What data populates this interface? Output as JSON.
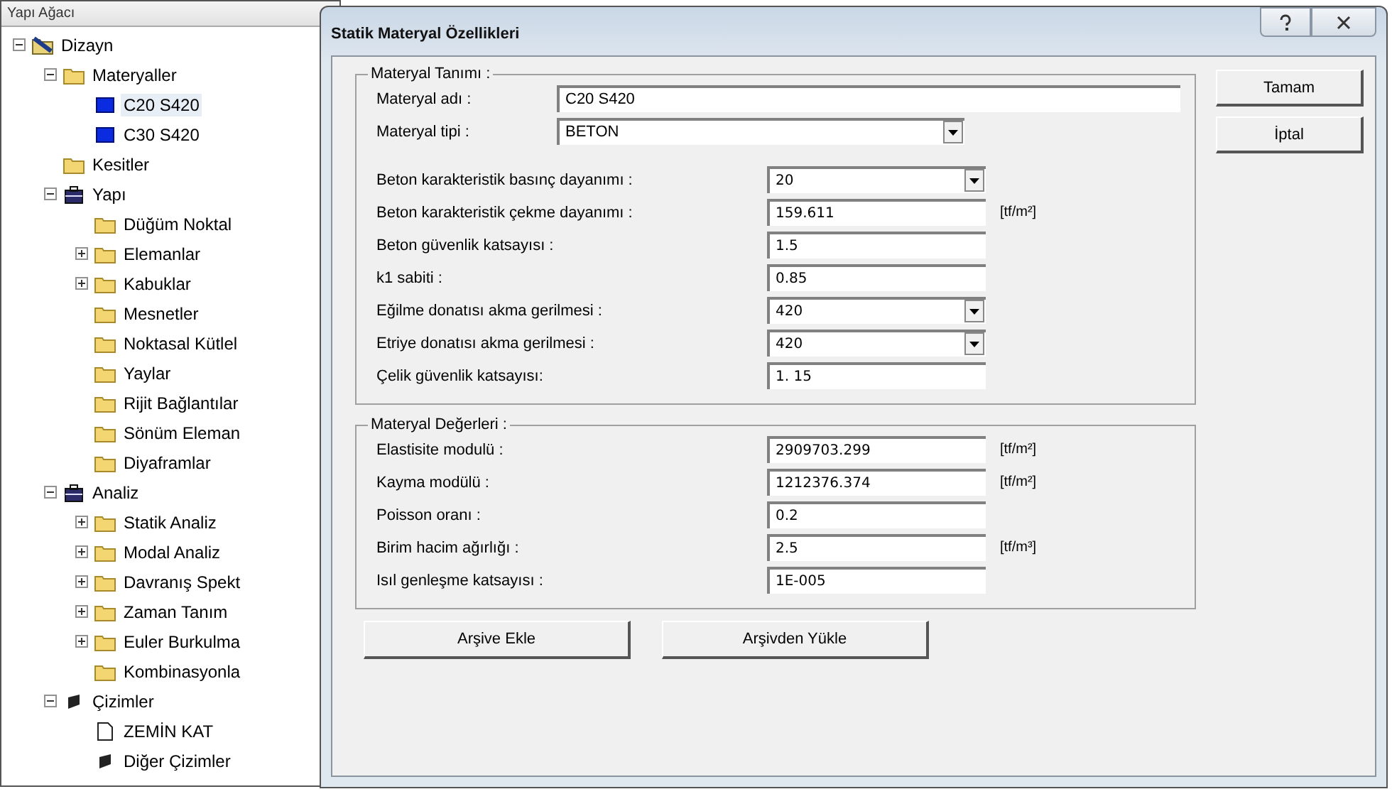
{
  "tree": {
    "title": "Yapı Ağacı",
    "items": [
      {
        "label": "Dizayn",
        "kind": "design",
        "expanded": true,
        "selected": false,
        "children": [
          {
            "label": "Materyaller",
            "kind": "folder",
            "expanded": true,
            "selected": false,
            "children": [
              {
                "label": "C20 S420",
                "kind": "material",
                "selected": true
              },
              {
                "label": "C30 S420",
                "kind": "material",
                "selected": false
              }
            ]
          },
          {
            "label": "Kesitler",
            "kind": "folder",
            "selected": false
          },
          {
            "label": "Yapı",
            "kind": "case",
            "expanded": true,
            "selected": false,
            "children": [
              {
                "label": "Düğüm Noktal",
                "kind": "folder",
                "selected": false
              },
              {
                "label": "Elemanlar",
                "kind": "folder",
                "expanded": false,
                "selected": false
              },
              {
                "label": "Kabuklar",
                "kind": "folder",
                "expanded": false,
                "selected": false
              },
              {
                "label": "Mesnetler",
                "kind": "folder",
                "selected": false
              },
              {
                "label": "Noktasal Kütlel",
                "kind": "folder",
                "selected": false
              },
              {
                "label": "Yaylar",
                "kind": "folder",
                "selected": false
              },
              {
                "label": "Rijit Bağlantılar",
                "kind": "folder",
                "selected": false
              },
              {
                "label": "Sönüm Eleman",
                "kind": "folder",
                "selected": false
              },
              {
                "label": "Diyaframlar",
                "kind": "folder",
                "selected": false
              }
            ]
          },
          {
            "label": "Analiz",
            "kind": "case",
            "expanded": true,
            "selected": false,
            "children": [
              {
                "label": "Statik Analiz",
                "kind": "folder",
                "expanded": false,
                "selected": false
              },
              {
                "label": "Modal Analiz",
                "kind": "folder",
                "expanded": false,
                "selected": false
              },
              {
                "label": "Davranış Spekt",
                "kind": "folder",
                "expanded": false,
                "selected": false
              },
              {
                "label": "Zaman Tanım",
                "kind": "folder",
                "expanded": false,
                "selected": false
              },
              {
                "label": "Euler Burkulma",
                "kind": "folder",
                "expanded": false,
                "selected": false
              },
              {
                "label": "Kombinasyonla",
                "kind": "folder",
                "selected": false
              }
            ]
          },
          {
            "label": "Çizimler",
            "kind": "drawing",
            "expanded": true,
            "selected": false,
            "children": [
              {
                "label": "ZEMİN KAT",
                "kind": "document",
                "selected": false
              },
              {
                "label": "Diğer Çizimler",
                "kind": "drawing",
                "selected": false
              }
            ]
          }
        ]
      }
    ]
  },
  "dialog": {
    "title": "Statik Materyal Özellikleri",
    "groups": [
      {
        "title": "Materyal Tanımı :",
        "rows": [
          {
            "label": "Materyal adı :",
            "value": "C20 S420",
            "kind": "wide"
          },
          {
            "label": "Materyal tipi :",
            "value": "BETON",
            "kind": "wide-combo"
          },
          {
            "label": "Beton karakteristik basınç dayanımı :",
            "value": "20",
            "kind": "combo"
          },
          {
            "label": "Beton karakteristik çekme dayanımı :",
            "value": "159.611",
            "kind": "text",
            "unit": "[tf/m²]"
          },
          {
            "label": "Beton güvenlik katsayısı :",
            "value": "1.5",
            "kind": "text"
          },
          {
            "label": "k1 sabiti :",
            "value": "0.85",
            "kind": "text"
          },
          {
            "label": "Eğilme donatısı akma gerilmesi :",
            "value": "420",
            "kind": "combo"
          },
          {
            "label": "Etriye donatısı akma gerilmesi :",
            "value": "420",
            "kind": "combo"
          },
          {
            "label": "Çelik güvenlik katsayısı:",
            "value": "1. 15",
            "kind": "text"
          }
        ]
      },
      {
        "title": "Materyal Değerleri :",
        "rows": [
          {
            "label": "Elastisite modulü :",
            "value": "2909703.299",
            "kind": "text",
            "unit": "[tf/m²]"
          },
          {
            "label": "Kayma modülü :",
            "value": "1212376.374",
            "kind": "text",
            "unit": "[tf/m²]"
          },
          {
            "label": "Poisson oranı :",
            "value": "0.2",
            "kind": "text"
          },
          {
            "label": "Birim hacim ağırlığı :",
            "value": "2.5",
            "kind": "text",
            "unit": "[tf/m³]"
          },
          {
            "label": "Isıl genleşme katsayısı :",
            "value": "1E-005",
            "kind": "text"
          }
        ]
      }
    ],
    "bottom_buttons": [
      "Arşive Ekle",
      "Arşivden Yükle"
    ],
    "side_buttons": [
      "Tamam",
      "İptal"
    ]
  }
}
